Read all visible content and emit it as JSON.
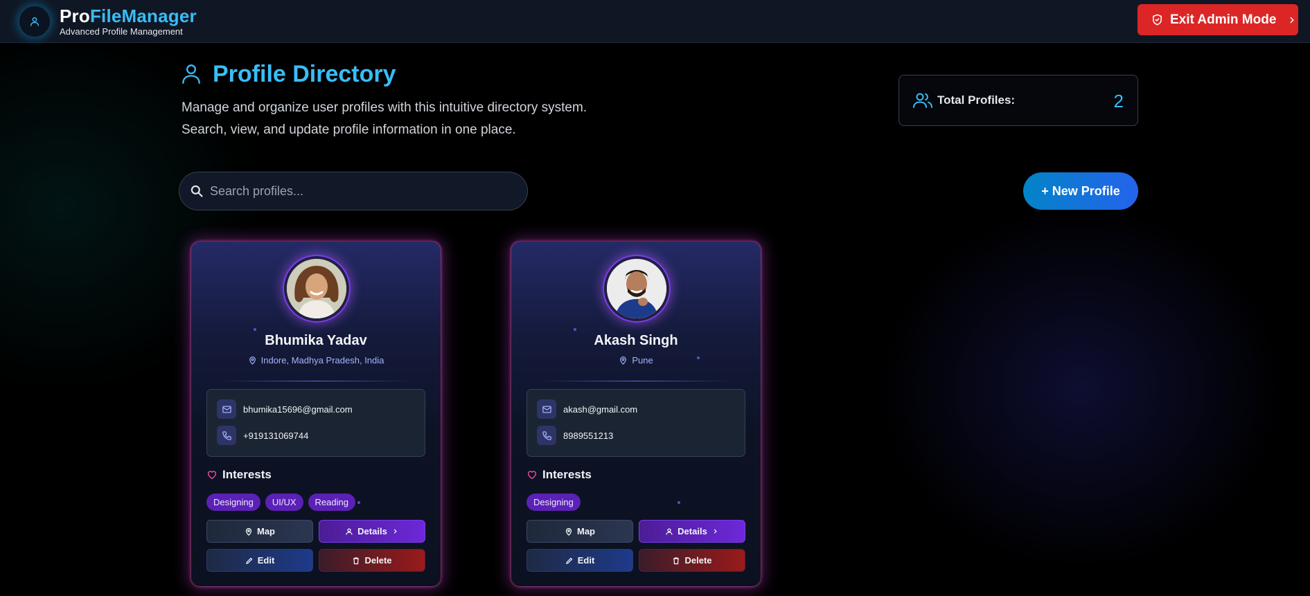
{
  "header": {
    "brand_part1": "Pro",
    "brand_part2": "FileManager",
    "subtitle": "Advanced Profile Management",
    "exit_label": "Exit Admin Mode",
    "logo_icon": "user-icon",
    "exit_icon": "shield-icon"
  },
  "page": {
    "title": "Profile Directory",
    "description_line1": "Manage and organize user profiles with this intuitive directory system.",
    "description_line2": "Search, view, and update profile information in one place.",
    "total_label": "Total Profiles:",
    "total_value": "2"
  },
  "toolbar": {
    "search_placeholder": "Search profiles...",
    "search_value": "",
    "new_profile_label": "+ New Profile"
  },
  "profiles": [
    {
      "name": "Bhumika Yadav",
      "location": "Indore, Madhya Pradesh, India",
      "email": "bhumika15696@gmail.com",
      "phone": "+919131069744",
      "interests_title": "Interests",
      "interests": [
        "Designing",
        "UI/UX",
        "Reading"
      ],
      "map_label": "Map",
      "details_label": "Details",
      "edit_label": "Edit",
      "delete_label": "Delete"
    },
    {
      "name": "Akash Singh",
      "location": "Pune",
      "email": "akash@gmail.com",
      "phone": "8989551213",
      "interests_title": "Interests",
      "interests": [
        "Designing"
      ],
      "map_label": "Map",
      "details_label": "Details",
      "edit_label": "Edit",
      "delete_label": "Delete"
    }
  ],
  "colors": {
    "accent": "#38bdf8",
    "exit_button": "#dc2626",
    "tag_bg": "#5b21b6",
    "card_glow": "#d946ef"
  }
}
